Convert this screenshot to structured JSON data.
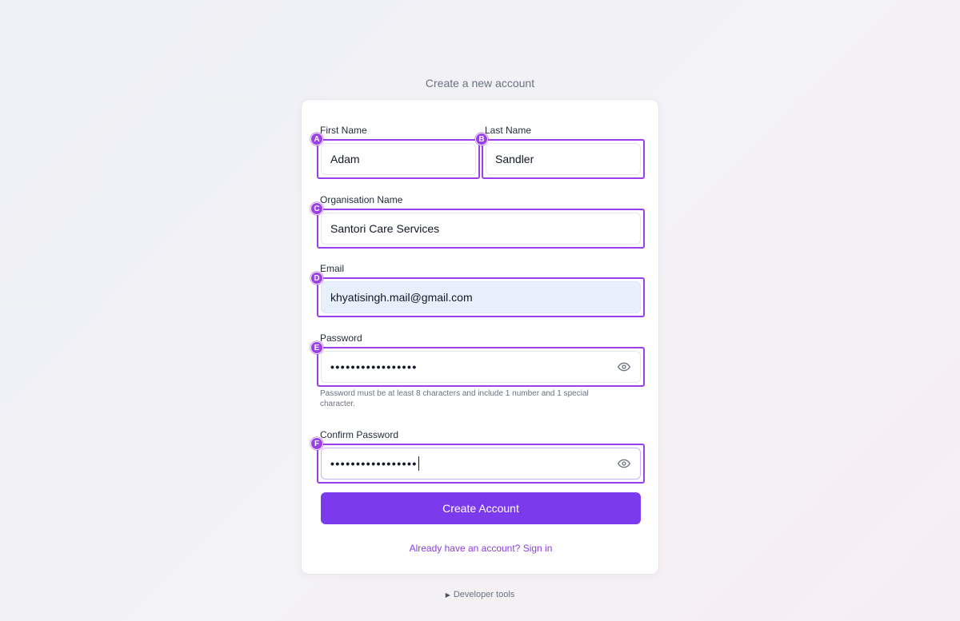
{
  "page": {
    "heading": "Create a new account",
    "developer_tools": "Developer tools"
  },
  "form": {
    "first_name": {
      "label": "First Name",
      "value": "Adam",
      "badge": "A"
    },
    "last_name": {
      "label": "Last Name",
      "value": "Sandler",
      "badge": "B"
    },
    "organisation": {
      "label": "Organisation Name",
      "value": "Santori Care Services",
      "badge": "C"
    },
    "email": {
      "label": "Email",
      "value": "khyatisingh.mail@gmail.com",
      "badge": "D"
    },
    "password": {
      "label": "Password",
      "value": "•••••••••••••••••",
      "badge": "E",
      "hint": "Password must be at least 8 characters and include 1 number and 1 special character."
    },
    "confirm_password": {
      "label": "Confirm Password",
      "value": "•••••••••••••••••",
      "badge": "F"
    },
    "submit_label": "Create Account",
    "signin_link": "Already have an account? Sign in"
  },
  "colors": {
    "accent": "#7c3aed",
    "annotation": "#9b3fe8",
    "autofill_bg": "#e8f0fd"
  },
  "icons": {
    "password_toggle": "eye-icon",
    "dev_tools_toggle": "triangle-right-icon"
  }
}
